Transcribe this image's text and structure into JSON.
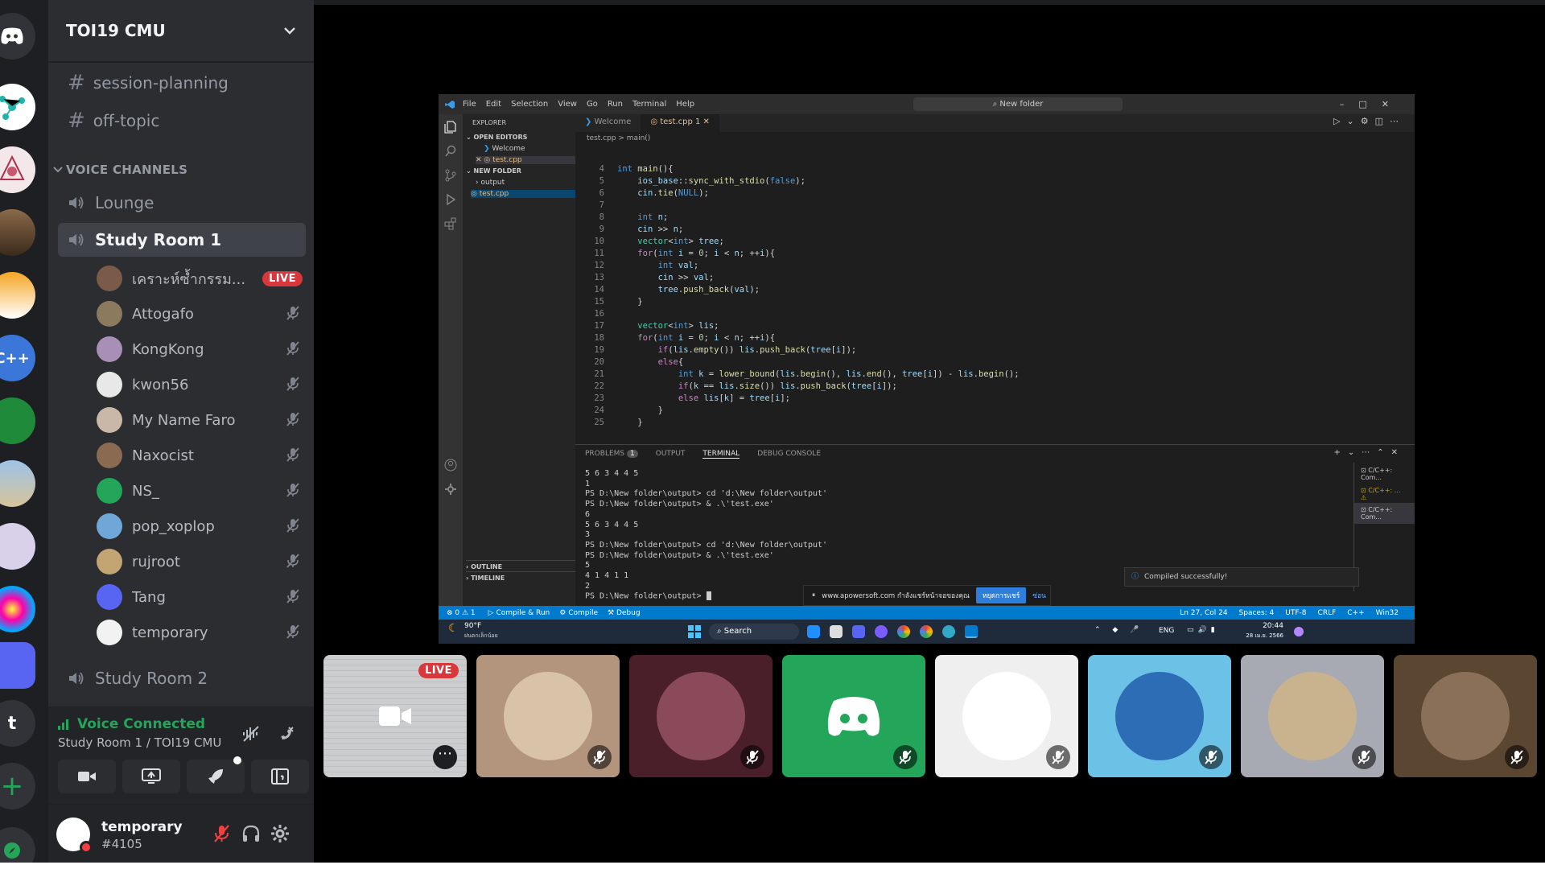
{
  "server": {
    "name": "TOI19 CMU"
  },
  "rail": {
    "guild_letter": "t"
  },
  "text_channels": [
    {
      "name": "session-planning"
    },
    {
      "name": "off-topic"
    }
  ],
  "voice_category": "VOICE CHANNELS",
  "voice_channels": [
    {
      "name": "Lounge"
    },
    {
      "name": "Study Room 1"
    },
    {
      "name": "Study Room 2"
    }
  ],
  "members": [
    {
      "name": "เคราะห์ซ้ำกรรม...",
      "live": "LIVE",
      "color": "#7a5a48"
    },
    {
      "name": "Attogafo",
      "color": "#8c7a5e"
    },
    {
      "name": "KongKong",
      "color": "#a88fb5"
    },
    {
      "name": "kwon56",
      "color": "#e8e8e8"
    },
    {
      "name": "My Name Faro",
      "color": "#c9b8a8"
    },
    {
      "name": "Naxocist",
      "color": "#8a6a50"
    },
    {
      "name": "NS_",
      "color": "#23a55a"
    },
    {
      "name": "pop_xoplop",
      "color": "#6fa8d8"
    },
    {
      "name": "rujroot",
      "color": "#c3a573"
    },
    {
      "name": "Tang",
      "color": "#5865f2"
    },
    {
      "name": "temporary",
      "color": "#f2f2f2"
    }
  ],
  "voice": {
    "status": "Voice Connected",
    "location": "Study Room 1 / TOI19 CMU"
  },
  "user": {
    "name": "temporary",
    "tag": "#4105"
  },
  "stream": {
    "menu": [
      "File",
      "Edit",
      "Selection",
      "View",
      "Go",
      "Run",
      "Terminal",
      "Help"
    ],
    "search": "New folder",
    "explorer_title": "EXPLORER",
    "open_editors": "OPEN EDITORS",
    "welcome_file": "Welcome",
    "cpp_file": "test.cpp",
    "new_folder": "NEW FOLDER",
    "output_folder": "output",
    "outline": "OUTLINE",
    "timeline": "TIMELINE",
    "tab_welcome": "Welcome",
    "tab_file": "test.cpp",
    "breadcrumb": "test.cpp > main()",
    "panel_tabs": [
      "PROBLEMS",
      "OUTPUT",
      "TERMINAL",
      "DEBUG CONSOLE"
    ],
    "terminal_lines": [
      "5 6 3 4 4 5",
      "1",
      "PS D:\\New folder\\output> cd 'd:\\New folder\\output'",
      "PS D:\\New folder\\output> & .\\'test.exe'",
      "6",
      "5 6 3 4 4 5",
      "3",
      "PS D:\\New folder\\output> cd 'd:\\New folder\\output'",
      "PS D:\\New folder\\output> & .\\'test.exe'",
      "5",
      "4 1 4 1 1",
      "2",
      "PS D:\\New folder\\output> "
    ],
    "toast": "Compiled successfully!",
    "status_left": [
      "⊗ 0 ⚠ 1",
      "Compile & Run",
      "Compile",
      "Debug"
    ],
    "status_right": [
      "Ln 27, Col 24",
      "Spaces: 4",
      "UTF-8",
      "CRLF",
      "C++",
      "Win32"
    ],
    "share_text": "www.apowersoft.com กำลังแชร์หน้าจอของคุณ",
    "share_stop": "หยุดการแชร์",
    "share_hide": "ซ่อน",
    "weather": "90°F",
    "weather_sub": "ฝนตกเล็กน้อย",
    "taskbar_search": "Search",
    "lang": "ENG",
    "time": "20:44",
    "date": "28 เม.ย. 2566",
    "terminals": [
      "C/C++: Com...",
      "C/C++: ...",
      "C/C++: Com..."
    ]
  },
  "tiles": [
    {
      "kind": "stream",
      "label": "LIVE",
      "bg": "#2b2d31"
    },
    {
      "kind": "avatar",
      "bg": "#b3957e",
      "face": "#d9c3a8"
    },
    {
      "kind": "avatar",
      "bg": "#4a1f2a",
      "face": "#8a4a5a"
    },
    {
      "kind": "avatar",
      "bg": "#23a55a",
      "face": "#23a55a"
    },
    {
      "kind": "avatar",
      "bg": "#efefef",
      "face": "#ffffff"
    },
    {
      "kind": "avatar",
      "bg": "#6cc1e6",
      "face": "#2d6db5"
    },
    {
      "kind": "avatar",
      "bg": "#a8aab3",
      "face": "#c9b38e"
    },
    {
      "kind": "avatar",
      "bg": "#5a4631",
      "face": "#8a7058"
    }
  ]
}
